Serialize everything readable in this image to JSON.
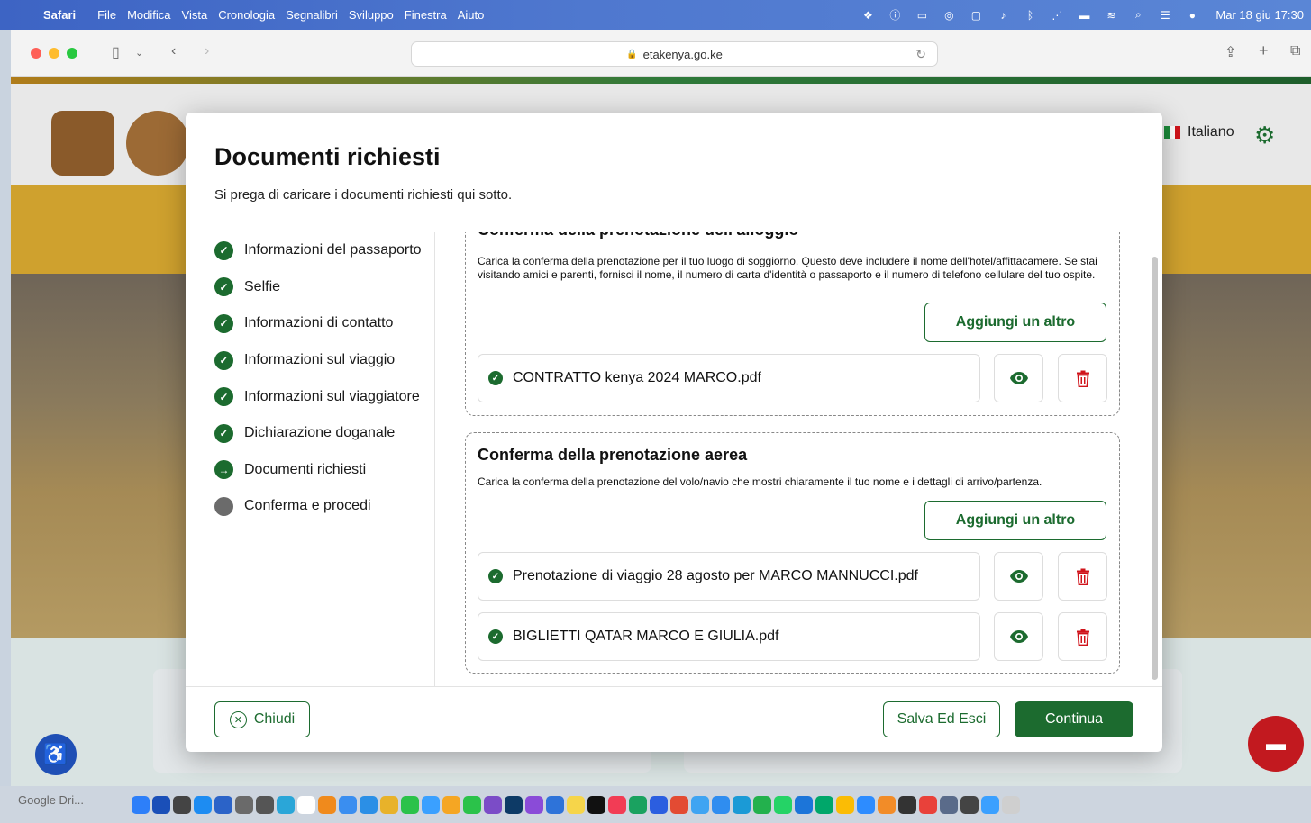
{
  "menubar": {
    "app": "Safari",
    "items": [
      "File",
      "Modifica",
      "Vista",
      "Cronologia",
      "Segnalibri",
      "Sviluppo",
      "Finestra",
      "Aiuto"
    ],
    "clock": "Mar 18 giu 17:30"
  },
  "browser": {
    "url": "etakenya.go.ke"
  },
  "page": {
    "language": "Italiano"
  },
  "modal": {
    "title": "Documenti richiesti",
    "subtitle": "Si prega di caricare i documenti richiesti qui sotto.",
    "steps": [
      {
        "label": "Informazioni del passaporto",
        "state": "done"
      },
      {
        "label": "Selfie",
        "state": "done"
      },
      {
        "label": "Informazioni di contatto",
        "state": "done"
      },
      {
        "label": "Informazioni sul viaggio",
        "state": "done"
      },
      {
        "label": "Informazioni sul viaggiatore",
        "state": "done"
      },
      {
        "label": "Dichiarazione doganale",
        "state": "done"
      },
      {
        "label": "Documenti richiesti",
        "state": "current"
      },
      {
        "label": "Conferma e procedi",
        "state": "pending"
      }
    ],
    "sections": [
      {
        "title": "Conferma della prenotazione dell'alloggio",
        "description": "Carica la conferma della prenotazione per il tuo luogo di soggiorno. Questo deve includere il nome dell'hotel/affittacamere. Se stai visitando amici e parenti, fornisci il nome, il numero di carta d'identità o passaporto e il numero di telefono cellulare del tuo ospite.",
        "add_label": "Aggiungi un altro",
        "files": [
          "CONTRATTO kenya 2024 MARCO.pdf"
        ]
      },
      {
        "title": "Conferma della prenotazione aerea",
        "description": "Carica la conferma della prenotazione del volo/navio che mostri chiaramente il tuo nome e i dettagli di arrivo/partenza.",
        "add_label": "Aggiungi un altro",
        "files": [
          "Prenotazione di viaggio 28 agosto per MARCO MANNUCCI.pdf",
          "BIGLIETTI QATAR MARCO E GIULIA.pdf"
        ]
      }
    ],
    "buttons": {
      "close": "Chiudi",
      "save_exit": "Salva Ed Esci",
      "continue": "Continua"
    }
  },
  "dock": {
    "left_label": "Google Dri..."
  },
  "colors": {
    "primary_green": "#1c6b2f",
    "delete_red": "#d0141b",
    "pending_gray": "#6b6b6b"
  }
}
